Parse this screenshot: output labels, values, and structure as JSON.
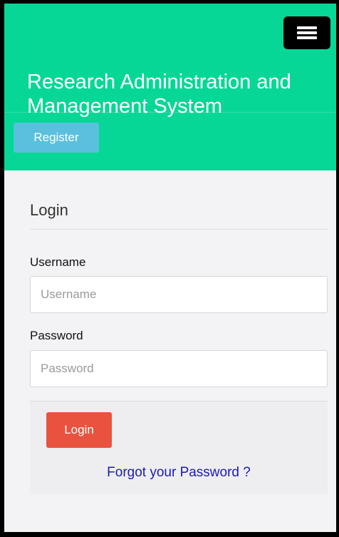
{
  "header": {
    "title": "Research Administration and Management System",
    "menu_icon": "hamburger-menu-icon",
    "register_label": "Register"
  },
  "login_form": {
    "title": "Login",
    "username": {
      "label": "Username",
      "value": "",
      "placeholder": "Username"
    },
    "password": {
      "label": "Password",
      "value": "",
      "placeholder": "Password"
    },
    "submit_label": "Login",
    "forgot_label": "Forgot your Password ?"
  },
  "colors": {
    "header_bg": "#07d796",
    "register_button": "#5bc0de",
    "login_button": "#e9523f",
    "link": "#1a1ab8",
    "page_bg": "#f3f3f5"
  }
}
